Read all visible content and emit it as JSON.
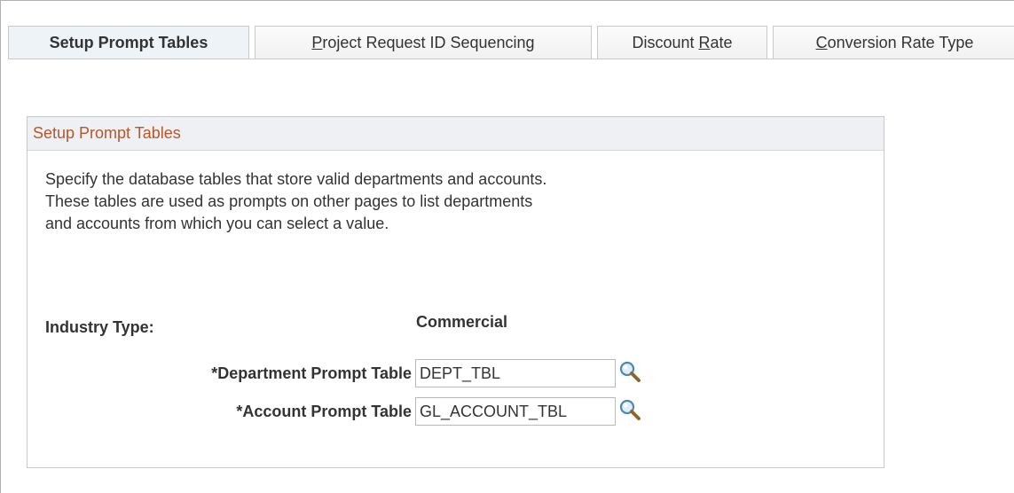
{
  "tabs": [
    {
      "label": "Setup Prompt Tables",
      "active": true
    },
    {
      "pre": "",
      "accel": "P",
      "post": "roject Request ID Sequencing"
    },
    {
      "pre": "Discount ",
      "accel": "R",
      "post": "ate"
    },
    {
      "pre": "",
      "accel": "C",
      "post": "onversion Rate Type"
    }
  ],
  "group": {
    "title": "Setup Prompt Tables",
    "description": [
      "Specify the database tables that store valid departments and accounts.",
      "These tables are used as prompts on other pages to list departments",
      "and accounts from which you can select a value."
    ]
  },
  "fields": {
    "industry_type_label": "Industry Type:",
    "industry_type_value": "Commercial",
    "department_label": "*Department Prompt Table",
    "department_value": "DEPT_TBL",
    "account_label": "*Account Prompt Table",
    "account_value": "GL_ACCOUNT_TBL"
  },
  "icons": {
    "lookup": "magnifier-icon"
  },
  "colors": {
    "group_title": "#b5572b",
    "active_tab_bg": "#eef3f8",
    "header_bg": "#eef0f3"
  }
}
